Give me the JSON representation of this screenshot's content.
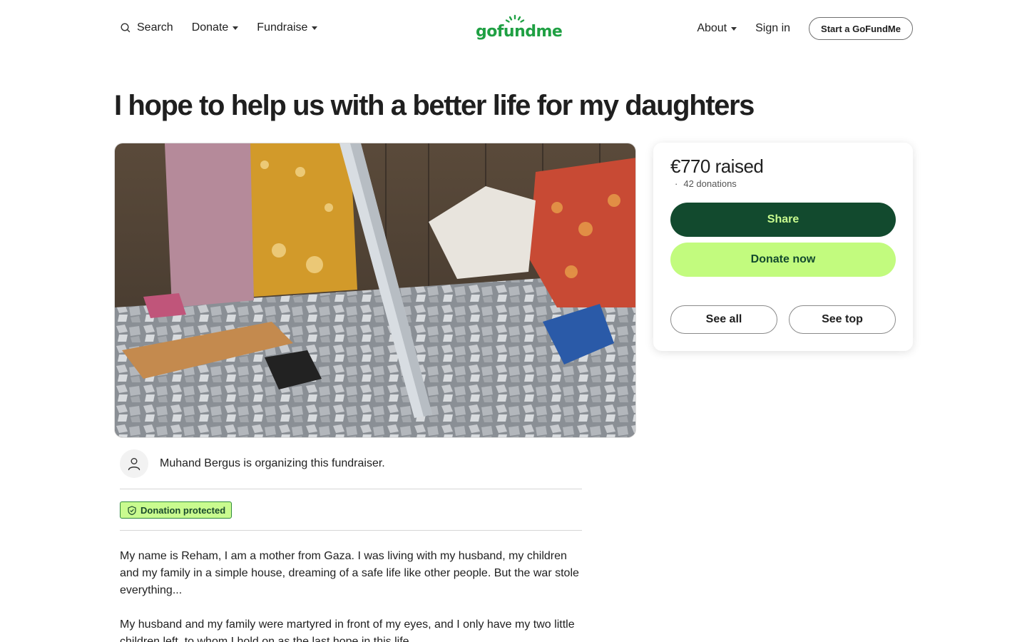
{
  "header": {
    "search_label": "Search",
    "donate_label": "Donate",
    "fundraise_label": "Fundraise",
    "logo_text": "gofundme",
    "about_label": "About",
    "signin_label": "Sign in",
    "start_label": "Start a GoFundMe"
  },
  "page": {
    "title": "I hope to help us with a better life for my daughters",
    "organizer_text": "Muhand Bergus is organizing this fundraiser.",
    "protected_label": "Donation protected",
    "story": [
      "My name is Reham, I am a mother from Gaza. I was living with my husband, my children and my family in a simple house, dreaming of a safe life like other people. But the war stole everything...",
      "My husband and my family were martyred in front of my eyes, and I only have my two little children left, to whom I hold on as the last hope in this life."
    ]
  },
  "card": {
    "raised": "€770 raised",
    "donations": "42 donations",
    "share_label": "Share",
    "donate_label": "Donate now",
    "see_all_label": "See all",
    "see_top_label": "See top"
  },
  "colors": {
    "brand_green": "#1fa043",
    "share_bg": "#124a2e",
    "donate_bg": "#c2fb7e",
    "badge_bg": "#c9fb8f"
  },
  "icons": {
    "search": "search-icon",
    "caret": "caret-down-icon",
    "avatar": "user-icon",
    "shield": "shield-icon"
  }
}
